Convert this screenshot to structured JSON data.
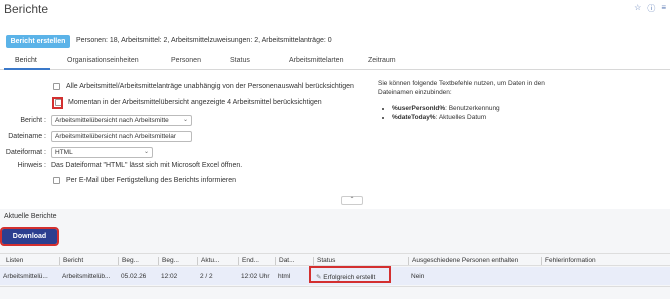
{
  "page": {
    "title": "Berichte"
  },
  "top_icons": [
    "star-icon",
    "help-icon",
    "menu-icon"
  ],
  "toolbar": {
    "create_label": "Bericht erstellen",
    "summary": "Personen: 18, Arbeitsmittel: 2, Arbeitsmittelzuweisungen: 2, Arbeitsmittelanträge: 0"
  },
  "tabs": [
    {
      "label": "Bericht",
      "active": true
    },
    {
      "label": "Organisationseinheiten"
    },
    {
      "label": "Personen"
    },
    {
      "label": "Status"
    },
    {
      "label": "Arbeitsmittelarten"
    },
    {
      "label": "Zeitraum"
    }
  ],
  "options": {
    "all_label": "Alle Arbeitsmittel/Arbeitsmittelanträge unabhängig von der Personenauswahl berücksichtigen",
    "current_label": "Momentan in der Arbeitsmittelübersicht angezeigte 4 Arbeitsmittel berücksichtigen",
    "email_label": "Per E-Mail über Fertigstellung des Berichts informieren"
  },
  "form": {
    "report_label": "Bericht :",
    "report_value": "Arbeitsmittelübersicht nach Arbeitsmitte",
    "filename_label": "Dateiname :",
    "filename_value": "Arbeitsmittelübersicht nach Arbeitsmittelar",
    "format_label": "Dateiformat :",
    "format_value": "HTML",
    "hint_label": "Hinweis :",
    "hint_text": "Das Dateiformat \"HTML\" lässt sich mit Microsoft Excel öffnen."
  },
  "help": {
    "text": "Sie können folgende Textbefehle nutzen, um Daten in den Dateinamen einzubinden:",
    "items": [
      {
        "cmd": "%userPersonId%",
        "desc": ": Benutzerkennung"
      },
      {
        "cmd": "%dateToday%",
        "desc": ": Aktuelles Datum"
      }
    ]
  },
  "current_reports": {
    "title": "Aktuelle Berichte",
    "download_label": "Download",
    "columns": [
      "Listen",
      "Bericht",
      "Beg...",
      "Beg...",
      "Aktu...",
      "End...",
      "Dat...",
      "Status",
      "Ausgeschiedene Personen enthalten",
      "Fehlerinformation"
    ],
    "rows": [
      [
        "Arbeitsmittelü...",
        "Arbeitsmittelüb...",
        "05.02.26",
        "12:02",
        "2 / 2",
        "12:02 Uhr",
        "html",
        "Erfolgreich erstellt",
        "Nein",
        ""
      ]
    ]
  }
}
